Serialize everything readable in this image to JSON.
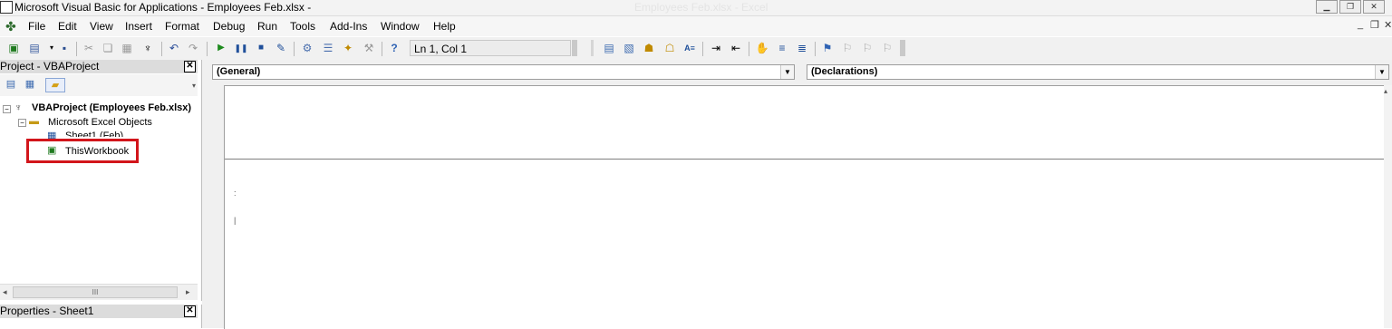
{
  "window": {
    "title": "Microsoft Visual Basic for Applications - Employees Feb.xlsx -",
    "background_title": "Employees Feb.xlsx - Excel"
  },
  "menu": {
    "items": [
      "File",
      "Edit",
      "View",
      "Insert",
      "Format",
      "Debug",
      "Run",
      "Tools",
      "Add-Ins",
      "Window",
      "Help"
    ]
  },
  "toolbar": {
    "position": "Ln 1, Col 1"
  },
  "project": {
    "header": "Project - VBAProject",
    "root": "VBAProject (Employees Feb.xlsx)",
    "folder": "Microsoft Excel Objects",
    "sheet": "Sheet1 (Feb)",
    "workbook": "ThisWorkbook",
    "scroll_thumb": "III"
  },
  "properties": {
    "header": "Properties - Sheet1"
  },
  "code": {
    "object_combo": "(General)",
    "procedure_combo": "(Declarations)"
  },
  "colors": {
    "highlight": "#d2151b"
  }
}
